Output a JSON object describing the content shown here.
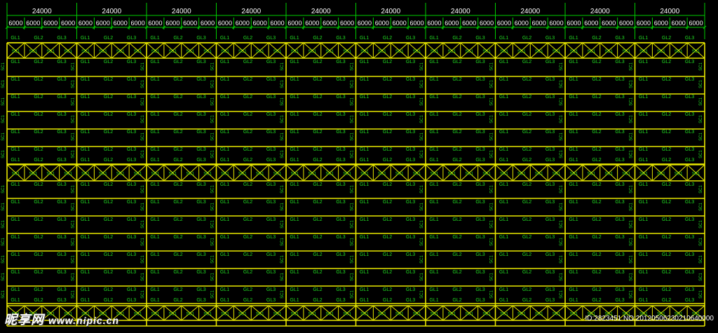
{
  "drawing": {
    "span_dimension": "24000",
    "bay_dimension": "6000",
    "span_count": 10,
    "bays_per_span": 4,
    "beam_labels": [
      "GL1",
      "GL2",
      "GL3"
    ],
    "column_label": "SC1",
    "brace_label": "SC1",
    "beam_rows": 15,
    "colors": {
      "background": "#000000",
      "structure": "#e8e800",
      "dimension": "#00cc00",
      "text": "#22dd22",
      "dim_text": "#ffffff"
    }
  },
  "watermark": {
    "logo": "昵享网",
    "site": "www.nipic.cn",
    "id_text": "ID:2823451 NO:20120506230210640000"
  }
}
